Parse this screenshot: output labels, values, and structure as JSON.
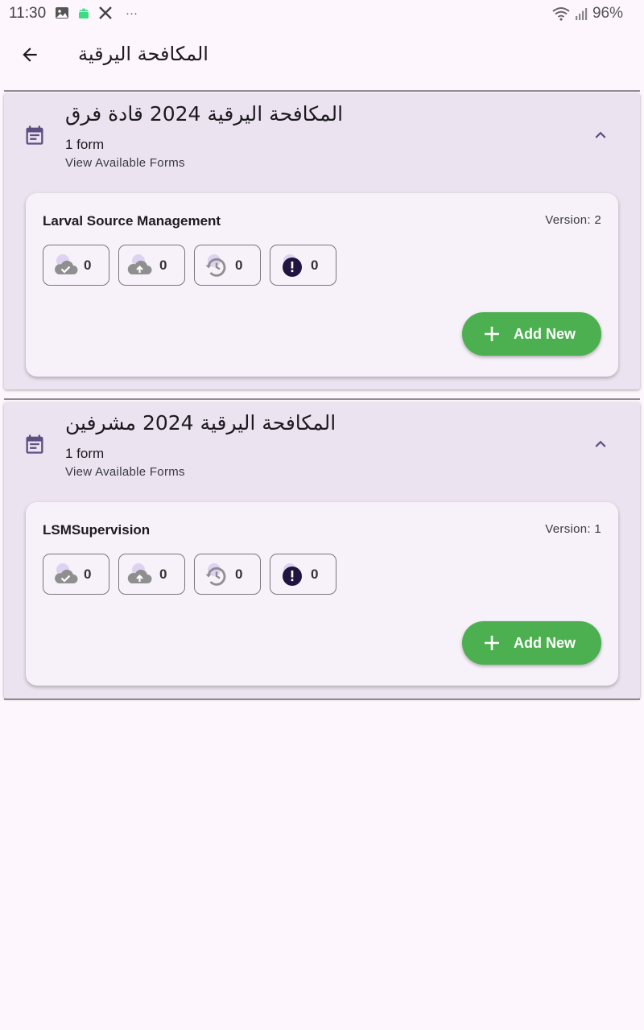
{
  "status_bar": {
    "time": "11:30",
    "battery": "96%",
    "left_icons": [
      "image-icon",
      "android-icon",
      "x-logo-icon",
      "more-dots-icon"
    ],
    "right_icons": [
      "wifi-icon",
      "signal-icon"
    ],
    "more_dots": "···"
  },
  "app_bar": {
    "title": "المكافحة اليرقية",
    "back_icon": "arrow-back-icon"
  },
  "groups": [
    {
      "title": "المكافحة اليرقية 2024 قادة فرق",
      "count": "1 form",
      "subtitle": "View Available Forms",
      "expanded": true,
      "forms": [
        {
          "name": "Larval Source Management",
          "version": "Version: 2",
          "counters": {
            "synced": "0",
            "pending_upload": "0",
            "drafts": "0",
            "errors": "0"
          },
          "add_label": "Add New"
        }
      ]
    },
    {
      "title": "المكافحة اليرقية 2024 مشرفين",
      "count": "1 form",
      "subtitle": "View Available Forms",
      "expanded": true,
      "forms": [
        {
          "name": "LSMSupervision",
          "version": "Version: 1",
          "counters": {
            "synced": "0",
            "pending_upload": "0",
            "drafts": "0",
            "errors": "0"
          },
          "add_label": "Add New"
        }
      ]
    }
  ],
  "colors": {
    "accent": "#5e4e82",
    "add_button": "#4caf50",
    "panel_bg": "#ebe4f0",
    "card_bg": "#f7f2f9",
    "page_bg": "#fdf7fd",
    "error_icon": "#1f1540"
  }
}
